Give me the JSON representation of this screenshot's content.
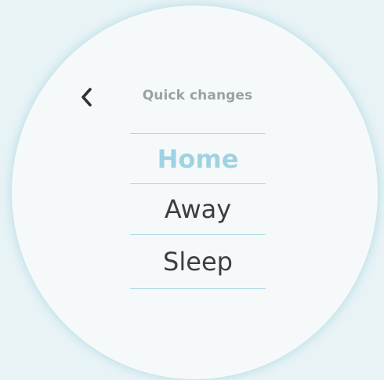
{
  "header": {
    "title": "Quick changes",
    "back_icon": "chevron-left-icon"
  },
  "options": [
    {
      "label": "Home",
      "selected": true
    },
    {
      "label": "Away",
      "selected": false
    },
    {
      "label": "Sleep",
      "selected": false
    }
  ],
  "colors": {
    "background": "#e8f3f6",
    "dial": "#f6f9fa",
    "accent": "#9fd3e1",
    "divider": "#a9d8e3",
    "text": "#3c3f41",
    "title": "#9aa1a6"
  }
}
